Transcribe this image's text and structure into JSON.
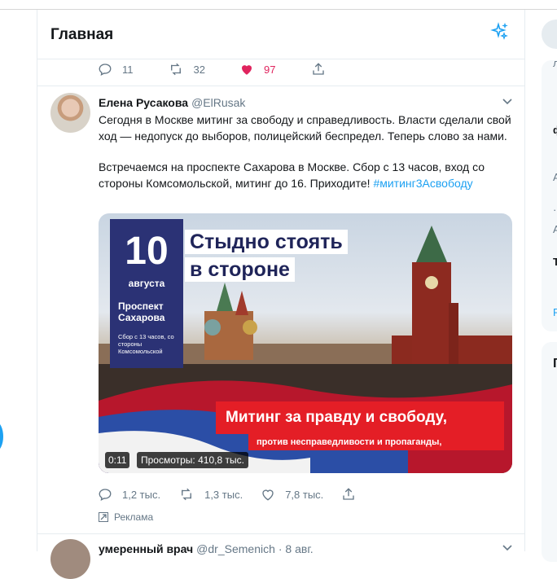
{
  "header": {
    "title": "Главная"
  },
  "prev_tweet_actions": {
    "replies": "11",
    "retweets": "32",
    "likes": "97"
  },
  "tweet": {
    "author_name": "Елена Русакова",
    "author_handle": "@ElRusak",
    "text_p1": "Сегодня в Москве митинг за свободу и справедливость. Власти сделали свой ход — недопуск до выборов, полицейский беспредел. Теперь слово за нами.",
    "text_p2": "Встречаемся на проспекте Сахарова в Москве. Сбор с 13 часов, вход со стороны Комсомольской, митинг до 16. Приходите!",
    "hashtag": "#митинг3Асвободу",
    "media": {
      "date_num": "10",
      "date_month": "августа",
      "place": "Проспект Сахарова",
      "small_text": "Сбор с 13 часов, со стороны Комсомольской",
      "headline_1": "Стыдно стоять",
      "headline_2": "в стороне",
      "banner_1": "Митинг за правду и свободу,",
      "banner_2": "против несправедливости и пропаганды,",
      "video_time": "0:11",
      "views": "Просмотры: 410,8 тыс."
    },
    "actions": {
      "replies": "1,2 тыс.",
      "retweets": "1,3 тыс.",
      "likes": "7,8 тыс."
    },
    "promoted_label": "Реклама"
  },
  "next_tweet": {
    "author_name": "умеренный врач",
    "author_handle": "@dr_Semenich",
    "date": "· 8 авг."
  },
  "colors": {
    "accent": "#1da1f2",
    "like": "#e0245e",
    "highlight": "#ffff33",
    "banner_red": "#e41e26"
  },
  "right_column_chars": [
    "л",
    "ф",
    "А",
    "·",
    "А",
    "·",
    "Т",
    "F",
    "Г"
  ]
}
